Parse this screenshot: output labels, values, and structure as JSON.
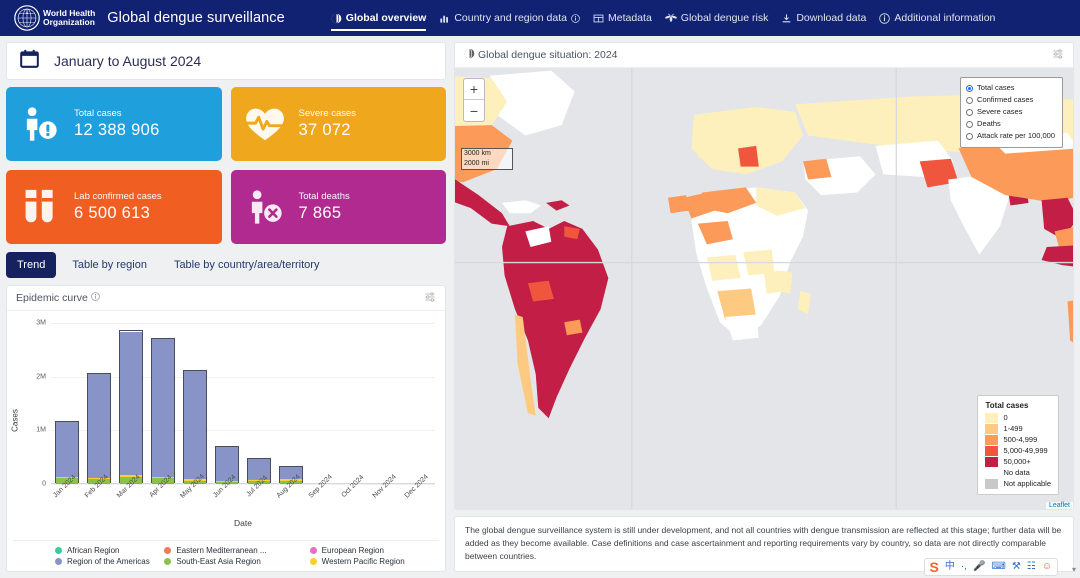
{
  "nav": {
    "org_line1": "World Health",
    "org_line2": "Organization",
    "app_title": "Global dengue surveillance",
    "items": [
      {
        "label": "Global overview",
        "icon": "globe-icon",
        "active": true
      },
      {
        "label": "Country and region data",
        "icon": "bar-chart-icon",
        "info": true
      },
      {
        "label": "Metadata",
        "icon": "table-icon"
      },
      {
        "label": "Global dengue risk",
        "icon": "mosquito-icon"
      },
      {
        "label": "Download data",
        "icon": "download-icon"
      },
      {
        "label": "Additional information",
        "icon": "info-icon"
      }
    ]
  },
  "date_bar": {
    "icon": "calendar-icon",
    "label": "January to August 2024"
  },
  "kpis": [
    {
      "title": "Total cases",
      "value": "12 388 906",
      "color": "#1FA0DC",
      "icon": "person-alert-icon"
    },
    {
      "title": "Severe cases",
      "value": "37 072",
      "color": "#EFA71E",
      "icon": "heart-pulse-icon"
    },
    {
      "title": "Lab confirmed cases",
      "value": "6 500 613",
      "color": "#F05E22",
      "icon": "test-tubes-icon"
    },
    {
      "title": "Total deaths",
      "value": "7 865",
      "color": "#B02A8F",
      "icon": "person-death-icon"
    }
  ],
  "tabs": [
    {
      "label": "Trend",
      "active": true
    },
    {
      "label": "Table by region",
      "active": false
    },
    {
      "label": "Table by country/area/territory",
      "active": false
    }
  ],
  "chart_card": {
    "title": "Epidemic curve",
    "info_icon": "info-icon",
    "settings_icon": "settings-sliders-icon"
  },
  "chart_data": {
    "type": "bar",
    "stacked": true,
    "title": "Epidemic curve",
    "xlabel": "Date",
    "ylabel": "Cases",
    "ylim": [
      0,
      3000000
    ],
    "yticks": [
      0,
      1000000,
      2000000,
      3000000
    ],
    "ytick_labels": [
      "0",
      "1M",
      "2M",
      "3M"
    ],
    "grid": true,
    "legend_position": "bottom",
    "categories": [
      "Jan 2024",
      "Feb 2024",
      "Mar 2024",
      "Apr 2024",
      "May 2024",
      "Jun 2024",
      "Jul 2024",
      "Aug 2024",
      "Sep 2024",
      "Oct 2024",
      "Nov 2024",
      "Dec 2024"
    ],
    "series": [
      {
        "name": "African Region",
        "color": "#3BC9A0",
        "values": [
          6000,
          6000,
          6000,
          6000,
          5000,
          3000,
          2000,
          2000,
          0,
          0,
          0,
          0
        ]
      },
      {
        "name": "Region of the Americas",
        "color": "#8894C8",
        "values": [
          1040000,
          1970000,
          2710000,
          2600000,
          2040000,
          640000,
          400000,
          240000,
          0,
          0,
          0,
          0
        ]
      },
      {
        "name": "Eastern Mediterranean ...",
        "color": "#F4795B",
        "values": [
          4000,
          4000,
          4000,
          4000,
          4000,
          3000,
          3000,
          3000,
          0,
          0,
          0,
          0
        ]
      },
      {
        "name": "South-East Asia Region",
        "color": "#8BC34A",
        "values": [
          90000,
          70000,
          110000,
          80000,
          40000,
          20000,
          40000,
          45000,
          0,
          0,
          0,
          0
        ]
      },
      {
        "name": "European Region",
        "color": "#E76FC0",
        "values": [
          500,
          500,
          500,
          500,
          500,
          500,
          500,
          500,
          0,
          0,
          0,
          0
        ]
      },
      {
        "name": "Western Pacific Region",
        "color": "#F8D030",
        "values": [
          20000,
          20000,
          30000,
          30000,
          25000,
          20000,
          25000,
          25000,
          0,
          0,
          0,
          0
        ]
      }
    ],
    "bar_totals": [
      1160000,
      2070000,
      2850000,
      2720000,
      2110000,
      683000,
      470000,
      315000,
      0,
      0,
      0,
      0
    ]
  },
  "map_card": {
    "header_icon": "globe-icon",
    "header_title": "Global dengue situation: 2024",
    "settings_icon": "settings-sliders-icon",
    "zoom_in": "+",
    "zoom_out": "−",
    "scale_km": "3000 km",
    "scale_mi": "2000 mi",
    "attribution": "Leaflet",
    "measures": [
      {
        "label": "Total cases",
        "selected": true
      },
      {
        "label": "Confirmed cases",
        "selected": false
      },
      {
        "label": "Severe cases",
        "selected": false
      },
      {
        "label": "Deaths",
        "selected": false
      },
      {
        "label": "Attack rate per 100,000",
        "selected": false
      }
    ],
    "legend_title": "Total cases",
    "legend_items": [
      {
        "label": "0",
        "color": "#FEF0BC"
      },
      {
        "label": "1-499",
        "color": "#FEC981"
      },
      {
        "label": "500-4,999",
        "color": "#FB9A59"
      },
      {
        "label": "5,000-49,999",
        "color": "#F0563E"
      },
      {
        "label": "50,000+",
        "color": "#C31F46"
      },
      {
        "label": "No data",
        "color": "#FFFFFF"
      },
      {
        "label": "Not applicable",
        "color": "#C9C9C9"
      }
    ]
  },
  "footnote": "The global dengue surveillance system is still under development, and not all countries with dengue transmission are reflected at this stage; further data will be added as they become available. Case definitions and case ascertainment and reporting requirements vary by country, so data are not directly comparable between countries.",
  "ime": {
    "logo": "sogou-logo-icon",
    "items": [
      "中",
      "·,",
      "mic-icon",
      "keyboard-icon",
      "toolbox-icon",
      "apps-icon",
      "smiley-icon"
    ]
  }
}
